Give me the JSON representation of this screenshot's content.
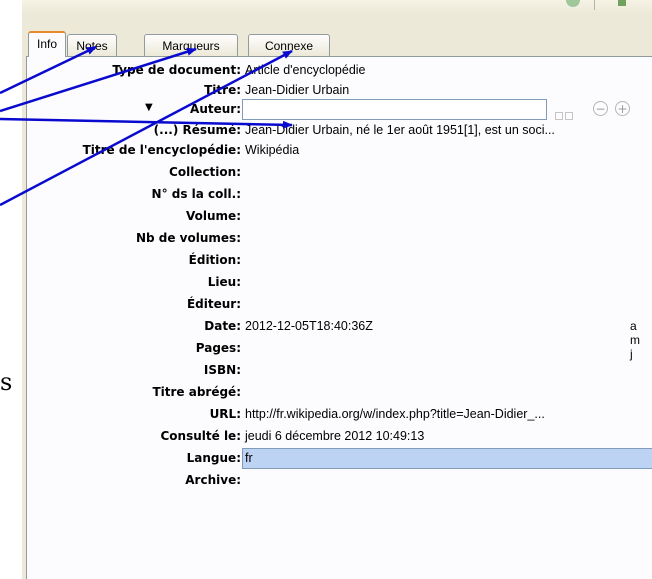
{
  "tabs": [
    {
      "label": "Info",
      "active": true
    },
    {
      "label": "Notes",
      "active": false
    },
    {
      "label": "Marqueurs",
      "active": false
    },
    {
      "label": "Connexe",
      "active": false
    }
  ],
  "fields": {
    "item_type": {
      "label": "Type de document:",
      "value": "Article d'encyclopédie"
    },
    "title": {
      "label": "Titre:",
      "value": "Jean-Didier Urbain"
    },
    "author": {
      "label": "Auteur:",
      "value": ""
    },
    "abstract": {
      "label": "(...) Résumé:",
      "value": "Jean-Didier Urbain, né le 1er août 1951[1], est un soci..."
    },
    "encyclopedia_title": {
      "label": "Titre de l'encyclopédie:",
      "value": "Wikipédia"
    },
    "series": {
      "label": "Collection:",
      "value": ""
    },
    "series_number": {
      "label": "N° ds la coll.:",
      "value": ""
    },
    "volume": {
      "label": "Volume:",
      "value": ""
    },
    "num_volumes": {
      "label": "Nb de volumes:",
      "value": ""
    },
    "edition": {
      "label": "Édition:",
      "value": ""
    },
    "place": {
      "label": "Lieu:",
      "value": ""
    },
    "publisher": {
      "label": "Éditeur:",
      "value": ""
    },
    "date": {
      "label": "Date:",
      "value": "2012-12-05T18:40:36Z",
      "format_hint": "a m j"
    },
    "pages": {
      "label": "Pages:",
      "value": ""
    },
    "isbn": {
      "label": "ISBN:",
      "value": ""
    },
    "short_title": {
      "label": "Titre abrégé:",
      "value": ""
    },
    "url": {
      "label": "URL:",
      "value": "http://fr.wikipedia.org/w/index.php?title=Jean-Didier_..."
    },
    "accessed": {
      "label": "Consulté le:",
      "value": "jeudi 6 décembre 2012 10:49:13"
    },
    "language": {
      "label": "Langue:",
      "value": "fr"
    },
    "archive": {
      "label": "Archive:",
      "value": ""
    }
  },
  "author_controls": {
    "remove_symbol": "−",
    "add_symbol": "+"
  },
  "side_text": "s",
  "colors": {
    "arrow": "#0a0acf",
    "panel_bg": "#ece9d8",
    "content_bg": "#fcfcfe",
    "active_tab_accent": "#e68b2c",
    "language_highlight": "#bcd3f4"
  },
  "icons": [
    "field-mode-toggle-icon",
    "remove-creator-icon",
    "add-creator-icon",
    "creator-type-triangle-icon"
  ]
}
